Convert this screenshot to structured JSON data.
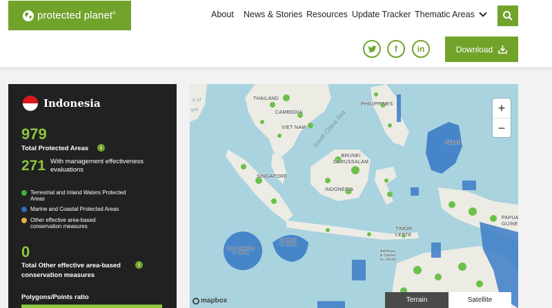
{
  "header": {
    "logo_text": "protected planet",
    "logo_mark": "®",
    "nav": [
      "About",
      "News & Stories",
      "Resources",
      "Update Tracker",
      "Thematic Areas"
    ],
    "download_label": "Download",
    "social": {
      "twitter": "twitter-icon",
      "facebook": "f",
      "linkedin": "in"
    }
  },
  "country_panel": {
    "country": "Indonesia",
    "total_pa_value": "979",
    "total_pa_label": "Total Protected Areas",
    "pame_value": "271",
    "pame_label": "With management effectiveness evaluations",
    "legend": [
      {
        "label": "Terrestrial and Inland Waters Protected Areas",
        "color": "#3fb33f"
      },
      {
        "label": "Marine and Coastal Protected Areas",
        "color": "#2d6dbf"
      },
      {
        "label": "Other effective area-based conservation measures",
        "color": "#e3b04b"
      }
    ],
    "oecm_value": "0",
    "oecm_label": "Total Other effective area-based conservation measures",
    "ratio_label": "Polygons/Points ratio"
  },
  "map": {
    "labels": {
      "thailand": "THAILAND",
      "cambodia": "CAMBODIA",
      "vietnam": "VIET NAM",
      "philippines": "PHILIPPINES",
      "palau": "PALAU",
      "brunei": "BRUNEI\nDARUSSALAM",
      "singapore": "SINGAPORE",
      "indonesia": "INDONESIA",
      "timor": "TIMOR-\nLESTE",
      "papua": "PAPUA\nGUINE",
      "gal": "gal",
      "cocos": "Cocos (Keeling)\nIs. (Aust)",
      "christmas": "Christmas\nIs. (Aust)",
      "ashmore": "Ashmore\n& Cartier\nIs. (Aust)",
      "sea": "South China Sea",
      "sea_left": "y of"
    },
    "zoom_in": "+",
    "zoom_out": "−",
    "attribution": "mapbox",
    "tabs": {
      "terrain": "Terrain",
      "satellite": "Satellite"
    }
  }
}
